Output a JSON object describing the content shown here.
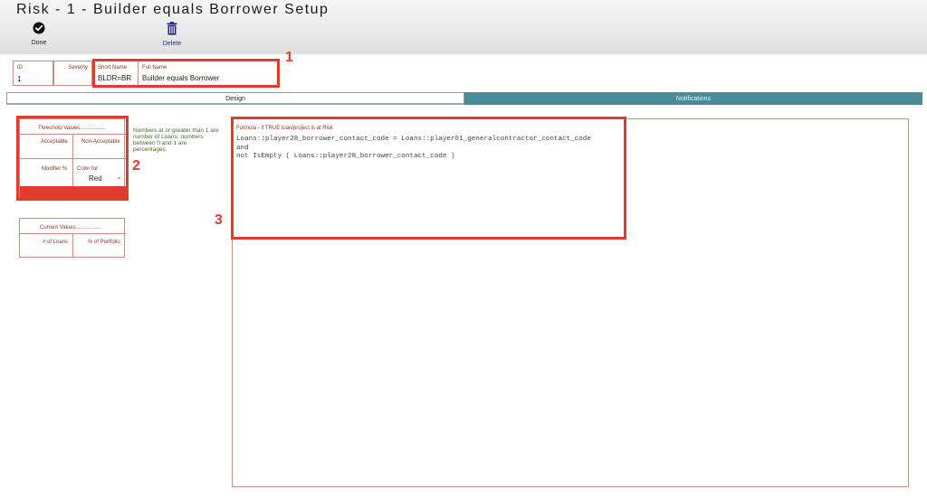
{
  "window": {
    "title": "Risk - 1 - Builder equals Borrower Setup"
  },
  "toolbar": {
    "done_label": "Done",
    "delete_label": "Delete"
  },
  "record": {
    "id_label": "ID",
    "id_value": "1",
    "severity_label": "Severity",
    "severity_value": "",
    "short_name_label": "Short Name",
    "short_name_value": "BLDR=BR",
    "full_name_label": "Full Name",
    "full_name_value": "Builder equals Borrower"
  },
  "tabs": [
    {
      "label": "Design",
      "active": true
    },
    {
      "label": "Notifications",
      "active": false
    }
  ],
  "threshold": {
    "title": "Threshold Values.................",
    "acceptable_label": "Acceptable",
    "non_acceptable_label": "Non-Acceptable",
    "modifier_label": "Modifier %",
    "color_for_label": "Color for",
    "color_value": "Red",
    "note": "Numbers at or greater than 1 are number of Loans; numbers between 0 and 1 are percentages."
  },
  "current": {
    "title": "Current Values.................",
    "loans_label": "# of Loans",
    "portfolio_label": "% of Portfolio"
  },
  "formula": {
    "label": "Formula - if TRUE loan/project is at Risk",
    "lines": [
      "Loans::player28_borrower_contact_code = Loans::player01_generalcontractor_contact_code",
      "and",
      "not IsEmpty ( Loans::player28_borrower_contact_code )"
    ]
  },
  "callouts": {
    "one": "1",
    "two": "2",
    "three": "3"
  },
  "colors": {
    "accent_red": "#e03c2c",
    "tab_teal": "#4a8a99",
    "field_border": "#c7907e",
    "label_brown": "#8a3a26"
  }
}
